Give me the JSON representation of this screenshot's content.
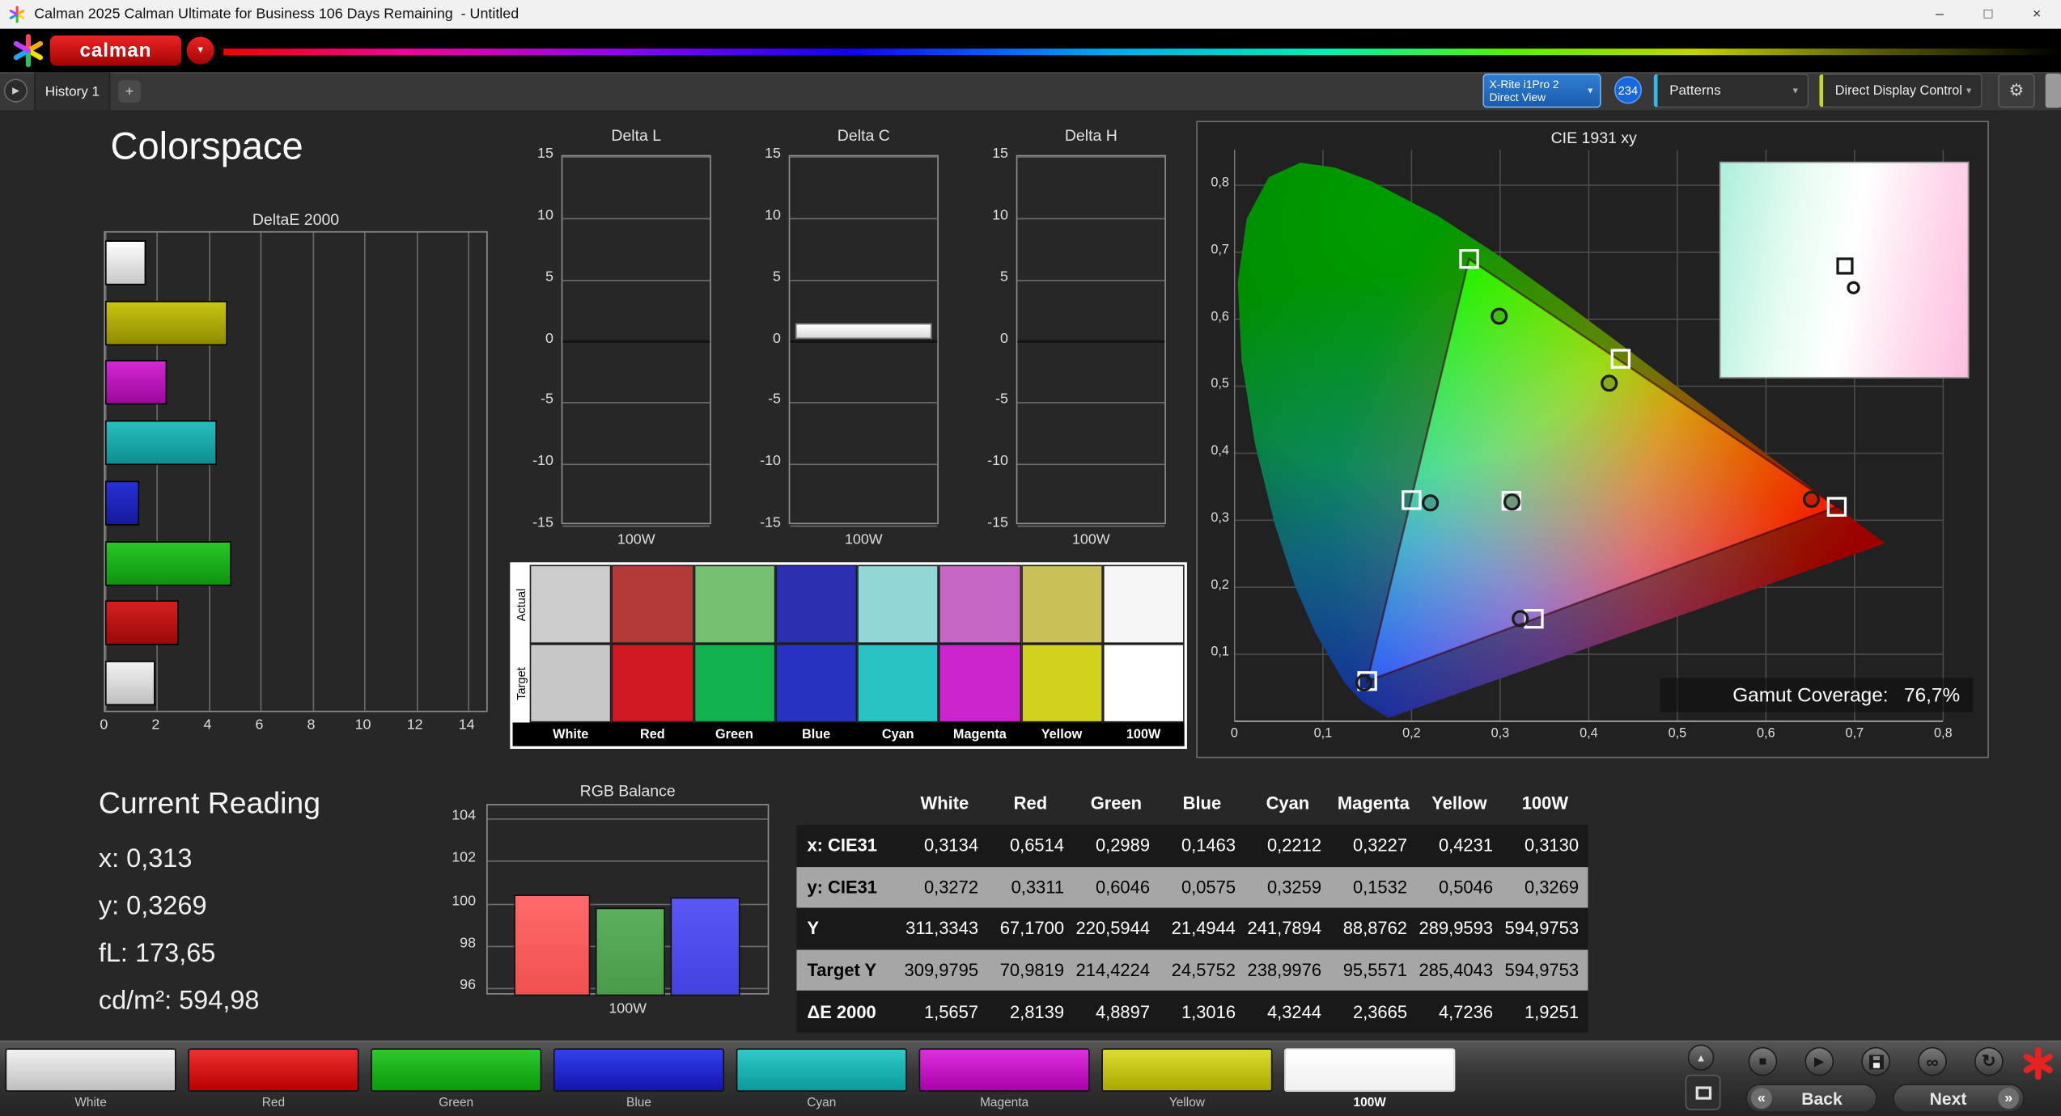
{
  "window": {
    "title": "Calman 2025 Calman Ultimate for Business 106 Days Remaining  - Untitled",
    "minimize": "–",
    "maximize": "□",
    "close": "×"
  },
  "brand": {
    "logo_text": "calman"
  },
  "tabbar": {
    "tab": "History 1",
    "add_tab": "+",
    "meter_line1": "X-Rite i1Pro 2",
    "meter_line2": "Direct View",
    "meter_count": "234",
    "patterns": "Patterns",
    "display_control": "Direct Display Control"
  },
  "icons": {
    "dropdown": "▼",
    "gear": "⚙",
    "history_expand": "▶",
    "up": "▲",
    "stop": "■",
    "play": "▶",
    "link": "∞",
    "refresh": "↻",
    "back_chevron": "«",
    "next_chevron": "»"
  },
  "page_title": "Colorspace",
  "current_reading": {
    "title": "Current Reading",
    "lines": [
      "x: 0,313",
      "y: 0,3269",
      "fL: 173,65",
      "cd/m²: 594,98"
    ]
  },
  "swatches": {
    "row_labels": [
      "Actual",
      "Target"
    ],
    "columns": [
      {
        "name": "White",
        "actual": "#cccccc",
        "target": "#c7c7c7"
      },
      {
        "name": "Red",
        "actual": "#b43a3a",
        "target": "#d01822"
      },
      {
        "name": "Green",
        "actual": "#74bf70",
        "target": "#12b24e"
      },
      {
        "name": "Blue",
        "actual": "#2a30b0",
        "target": "#2832c0"
      },
      {
        "name": "Cyan",
        "actual": "#92d6d6",
        "target": "#28c4c4"
      },
      {
        "name": "Magenta",
        "actual": "#c566c5",
        "target": "#cc24cc"
      },
      {
        "name": "Yellow",
        "actual": "#c9c058",
        "target": "#d2d21e"
      },
      {
        "name": "100W",
        "actual": "#f5f5f5",
        "target": "#ffffff"
      }
    ]
  },
  "gamut": {
    "label": "Gamut Coverage:",
    "value": "76,7%"
  },
  "bottom": {
    "back": "Back",
    "next": "Next",
    "patterns": [
      {
        "name": "White",
        "c1": "#f2f2f2",
        "c2": "#bfbfbf",
        "selected": false
      },
      {
        "name": "Red",
        "c1": "#ee3030",
        "c2": "#b80000",
        "selected": false
      },
      {
        "name": "Green",
        "c1": "#2fc82f",
        "c2": "#0a9a0a",
        "selected": false
      },
      {
        "name": "Blue",
        "c1": "#3340ee",
        "c2": "#1414ae",
        "selected": false
      },
      {
        "name": "Cyan",
        "c1": "#30caca",
        "c2": "#0a9a9a",
        "selected": false
      },
      {
        "name": "Magenta",
        "c1": "#dd30dd",
        "c2": "#a800a8",
        "selected": false
      },
      {
        "name": "Yellow",
        "c1": "#dcdc30",
        "c2": "#a8a800",
        "selected": false
      },
      {
        "name": "100W",
        "c1": "#ffffff",
        "c2": "#f0f0f0",
        "selected": true
      }
    ]
  },
  "chart_data": [
    {
      "id": "deltae2000",
      "type": "bar",
      "orientation": "horizontal",
      "title": "DeltaE 2000",
      "xticks": [
        0,
        2,
        4,
        6,
        8,
        10,
        12,
        14
      ],
      "xlim": [
        0,
        14.8
      ],
      "categories": [
        "White",
        "Yellow",
        "Magenta",
        "Cyan",
        "Blue",
        "Green",
        "Red",
        "100W"
      ],
      "values": [
        1.5657,
        4.7236,
        2.3665,
        4.3244,
        1.3016,
        4.8897,
        2.8139,
        1.9251
      ],
      "bar_colors": [
        [
          "#ffffff",
          "#c8c8c8"
        ],
        [
          "#c8c414",
          "#8f8c00"
        ],
        [
          "#d428d4",
          "#9c089c"
        ],
        [
          "#28bebe",
          "#0e8f8f"
        ],
        [
          "#2830d8",
          "#141a9a"
        ],
        [
          "#28c828",
          "#0f9410"
        ],
        [
          "#d42020",
          "#9c0808"
        ],
        [
          "#f2f2f2",
          "#bfbfbf"
        ]
      ]
    },
    {
      "id": "delta_l",
      "type": "bar",
      "title": "Delta L",
      "yticks": [
        15,
        10,
        5,
        0,
        -5,
        -10,
        -15
      ],
      "ylim": [
        -15,
        15
      ],
      "categories": [
        "100W"
      ],
      "values": [
        0
      ],
      "xlabel": "100W"
    },
    {
      "id": "delta_c",
      "type": "bar",
      "title": "Delta C",
      "yticks": [
        15,
        10,
        5,
        0,
        -5,
        -10,
        -15
      ],
      "ylim": [
        -15,
        15
      ],
      "categories": [
        "100W"
      ],
      "values": [
        1.3
      ],
      "xlabel": "100W"
    },
    {
      "id": "delta_h",
      "type": "bar",
      "title": "Delta H",
      "yticks": [
        15,
        10,
        5,
        0,
        -5,
        -10,
        -15
      ],
      "ylim": [
        -15,
        15
      ],
      "categories": [
        "100W"
      ],
      "values": [
        0
      ],
      "xlabel": "100W"
    },
    {
      "id": "rgb_balance",
      "type": "bar",
      "title": "RGB Balance",
      "yticks": [
        104,
        102,
        100,
        98,
        96
      ],
      "ylim": [
        96,
        104
      ],
      "xlabel": "100W",
      "categories": [
        "Red",
        "Green",
        "Blue"
      ],
      "values": [
        100.4,
        99.8,
        100.3
      ],
      "bar_colors": [
        [
          "#ff6a6a",
          "#f05050"
        ],
        [
          "#5cb05c",
          "#4a9a4a"
        ],
        [
          "#5858f5",
          "#4343e0"
        ]
      ]
    },
    {
      "id": "cie1931",
      "type": "scatter",
      "title": "CIE 1931 xy",
      "xticks": [
        "0",
        "0,1",
        "0,2",
        "0,3",
        "0,4",
        "0,5",
        "0,6",
        "0,7",
        "0,8"
      ],
      "yticks": [
        "0,8",
        "0,7",
        "0,6",
        "0,5",
        "0,4",
        "0,3",
        "0,2",
        "0,1"
      ],
      "gamut_coverage": "76,7%",
      "triangle_target": [
        [
          0.68,
          0.32
        ],
        [
          0.265,
          0.69
        ],
        [
          0.15,
          0.06
        ]
      ],
      "targets": [
        {
          "name": "White",
          "x": 0.3127,
          "y": 0.329
        },
        {
          "name": "Red",
          "x": 0.68,
          "y": 0.32
        },
        {
          "name": "Green",
          "x": 0.265,
          "y": 0.69
        },
        {
          "name": "Blue",
          "x": 0.15,
          "y": 0.06
        },
        {
          "name": "Cyan",
          "x": 0.2,
          "y": 0.33
        },
        {
          "name": "Magenta",
          "x": 0.338,
          "y": 0.153
        },
        {
          "name": "Yellow",
          "x": 0.436,
          "y": 0.541
        }
      ],
      "measurements": [
        {
          "name": "White",
          "x": 0.3134,
          "y": 0.3272
        },
        {
          "name": "Red",
          "x": 0.6514,
          "y": 0.3311
        },
        {
          "name": "Green",
          "x": 0.2989,
          "y": 0.6046
        },
        {
          "name": "Blue",
          "x": 0.1463,
          "y": 0.0575
        },
        {
          "name": "Cyan",
          "x": 0.2212,
          "y": 0.3259
        },
        {
          "name": "Magenta",
          "x": 0.3227,
          "y": 0.1532
        },
        {
          "name": "Yellow",
          "x": 0.4231,
          "y": 0.5046
        }
      ]
    },
    {
      "id": "measurement_table",
      "type": "table",
      "headers": [
        "",
        "White",
        "Red",
        "Green",
        "Blue",
        "Cyan",
        "Magenta",
        "Yellow",
        "100W"
      ],
      "rows": [
        {
          "label": "x: CIE31",
          "values": [
            "0,3134",
            "0,6514",
            "0,2989",
            "0,1463",
            "0,2212",
            "0,3227",
            "0,4231",
            "0,3130"
          ]
        },
        {
          "label": "y: CIE31",
          "values": [
            "0,3272",
            "0,3311",
            "0,6046",
            "0,0575",
            "0,3259",
            "0,1532",
            "0,5046",
            "0,3269"
          ]
        },
        {
          "label": "Y",
          "values": [
            "311,3343",
            "67,1700",
            "220,5944",
            "21,4944",
            "241,7894",
            "88,8762",
            "289,9593",
            "594,9753"
          ]
        },
        {
          "label": "Target Y",
          "values": [
            "309,9795",
            "70,9819",
            "214,4224",
            "24,5752",
            "238,9976",
            "95,5571",
            "285,4043",
            "594,9753"
          ]
        },
        {
          "label": "ΔE 2000",
          "values": [
            "1,5657",
            "2,8139",
            "4,8897",
            "1,3016",
            "4,3244",
            "2,3665",
            "4,7236",
            "1,9251"
          ]
        }
      ]
    }
  ]
}
